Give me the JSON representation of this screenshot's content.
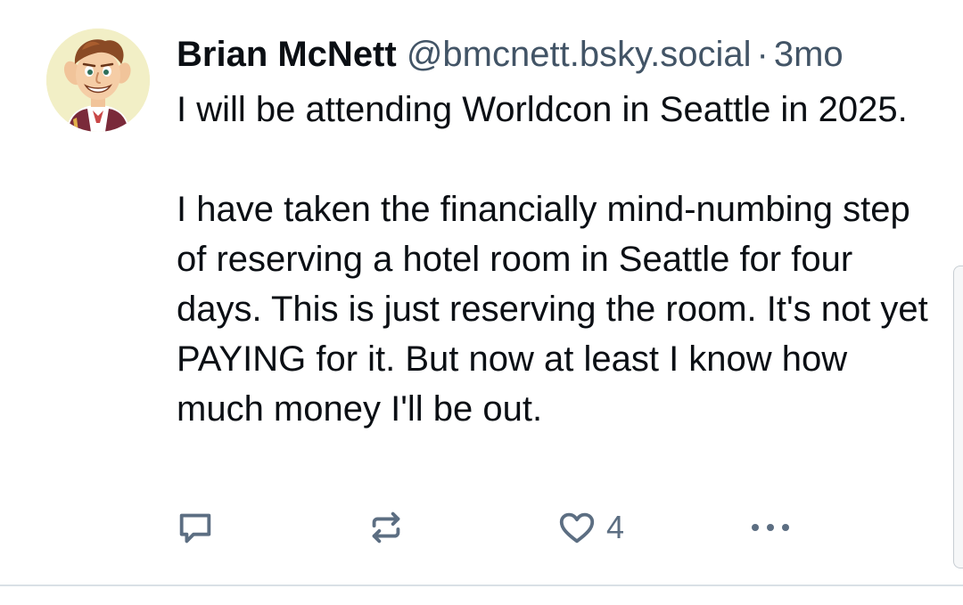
{
  "post": {
    "author": {
      "display_name": "Brian McNett",
      "handle": "@bmcnett.bsky.social",
      "separator": "·",
      "time": "3mo",
      "avatar_icon": "cartoon-avatar-icon"
    },
    "body": {
      "paragraph_1": "I will be attending Worldcon in Seattle in 2025.",
      "paragraph_2": "I have taken the financially mind-numbing step of reserving a hotel room in Seattle for four days. This is just reserving the room. It's not yet PAYING for it. But now at least I know how much money I'll be out."
    },
    "actions": {
      "reply_icon": "reply-icon",
      "repost_icon": "repost-icon",
      "like_icon": "heart-icon",
      "like_count": "4",
      "more_icon": "more-dots-icon"
    }
  },
  "colors": {
    "text_primary": "#0b0f14",
    "text_secondary": "#425466",
    "action_gray": "#5c6e82",
    "divider": "#d9e0e6"
  }
}
